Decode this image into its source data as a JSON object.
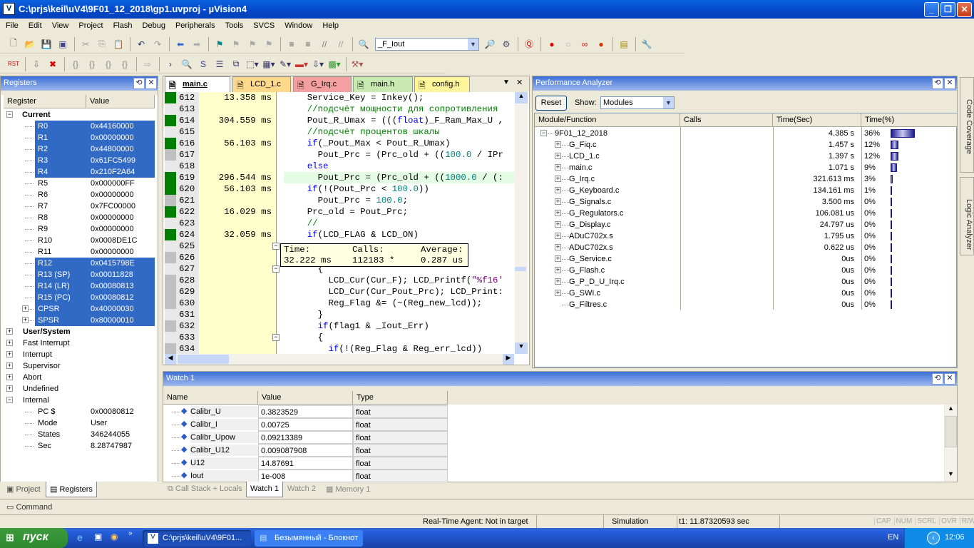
{
  "window": {
    "title": "C:\\prjs\\keil\\uV4\\9F01_12_2018\\gp1.uvproj - µVision4",
    "minimize": "_",
    "maximize": "❐",
    "close": "✕"
  },
  "menu": [
    "File",
    "Edit",
    "View",
    "Project",
    "Flash",
    "Debug",
    "Peripherals",
    "Tools",
    "SVCS",
    "Window",
    "Help"
  ],
  "toolbar1": {
    "icons": [
      [
        "new-file-icon",
        "🗋",
        "#555"
      ],
      [
        "open-icon",
        "📂",
        "#c90"
      ],
      [
        "save-icon",
        "💾",
        "#339"
      ],
      [
        "save-all-icon",
        "▣",
        "#448"
      ],
      "|",
      [
        "cut-icon",
        "✂",
        "#999"
      ],
      [
        "copy-icon",
        "⎘",
        "#999"
      ],
      [
        "paste-icon",
        "📋",
        "#a80"
      ],
      "|",
      [
        "undo-icon",
        "↶",
        "#236"
      ],
      [
        "redo-icon",
        "↷",
        "#999"
      ],
      "|",
      [
        "nav-back-icon",
        "⬅",
        "#36c"
      ],
      [
        "nav-forward-icon",
        "➡",
        "#aaa"
      ],
      "|",
      [
        "bookmark-icon",
        "⚑",
        "#088"
      ],
      [
        "bookmark-prev-icon",
        "⚑",
        "#aaa"
      ],
      [
        "bookmark-next-icon",
        "⚑",
        "#aaa"
      ],
      [
        "bookmark-clear-icon",
        "⚑",
        "#aaa"
      ],
      "|",
      [
        "indent-icon",
        "≡",
        "#555"
      ],
      [
        "unindent-icon",
        "≡",
        "#555"
      ],
      [
        "comment-icon",
        "//",
        "#777"
      ],
      [
        "uncomment-icon",
        "//",
        "#999"
      ],
      "|",
      [
        "find-in-files-icon",
        "🔍",
        "#a80"
      ]
    ],
    "find_value": "_F_Iout",
    "icons_after": [
      [
        "find-icon",
        "🔎",
        "#446"
      ],
      [
        "incremental-find-icon",
        "⚙",
        "#446"
      ],
      "|",
      [
        "debug-session-icon",
        "Ⓠ",
        "#c00"
      ],
      "|",
      [
        "breakpoint-icon",
        "●",
        "#d00"
      ],
      [
        "breakpoint-disable-icon",
        "○",
        "#aaa"
      ],
      [
        "breakpoints-disable-all-icon",
        "∞",
        "#d00"
      ],
      [
        "breakpoints-kill-all-icon",
        "●",
        "#c30"
      ],
      "|",
      [
        "window-config-icon",
        "▤",
        "#a80"
      ],
      "|",
      [
        "configure-icon",
        "🔧",
        "#445"
      ]
    ]
  },
  "toolbar2": {
    "icons": [
      [
        "reset-icon",
        "RST",
        "#c00"
      ],
      "|",
      [
        "run-icon",
        "⇩",
        "#777"
      ],
      [
        "stop-icon",
        "✖",
        "#d00"
      ],
      "|",
      [
        "step-into-icon",
        "{}",
        "#888"
      ],
      [
        "step-over-icon",
        "{}",
        "#888"
      ],
      [
        "step-out-icon",
        "{}",
        "#888"
      ],
      [
        "run-to-cursor-icon",
        "{}",
        "#888"
      ],
      "|",
      [
        "show-next-statement-icon",
        "⇨",
        "#aaa"
      ],
      "|",
      [
        "command-window-icon",
        "›",
        "#336"
      ],
      [
        "disassembly-window-icon",
        "🔍",
        "#336"
      ],
      [
        "symbols-window-icon",
        "S",
        "#339"
      ],
      [
        "registers-window-icon",
        "☰",
        "#336"
      ],
      [
        "call-stack-window-icon",
        "⧉",
        "#336"
      ],
      [
        "watch-window-icon",
        "⬚▾",
        "#336"
      ],
      [
        "memory-window-icon",
        "▦▾",
        "#336"
      ],
      [
        "serial-window-icon",
        "✎▾",
        "#336"
      ],
      [
        "analysis-window-icon",
        "▬▾",
        "#c33"
      ],
      [
        "trace-window-icon",
        "⇩▾",
        "#336"
      ],
      [
        "system-viewer-icon",
        "▩▾",
        "#393"
      ],
      "|",
      [
        "toolbox-icon",
        "⚒▾",
        "#a55"
      ]
    ]
  },
  "registers": {
    "title": "Registers",
    "columns": [
      "Register",
      "Value"
    ],
    "current_label": "Current",
    "current": [
      [
        "R0",
        "0x44160000",
        1
      ],
      [
        "R1",
        "0x00000000",
        1
      ],
      [
        "R2",
        "0x44800000",
        1
      ],
      [
        "R3",
        "0x61FC5499",
        1
      ],
      [
        "R4",
        "0x210F2A64",
        1
      ],
      [
        "R5",
        "0x000000FF",
        0
      ],
      [
        "R6",
        "0x00000000",
        0
      ],
      [
        "R7",
        "0x7FC00000",
        0
      ],
      [
        "R8",
        "0x00000000",
        0
      ],
      [
        "R9",
        "0x00000000",
        0
      ],
      [
        "R10",
        "0x0008DE1C",
        0
      ],
      [
        "R11",
        "0x00000000",
        0
      ],
      [
        "R12",
        "0x0415798E",
        1
      ],
      [
        "R13 (SP)",
        "0x00011828",
        1
      ],
      [
        "R14 (LR)",
        "0x00080813",
        1
      ],
      [
        "R15 (PC)",
        "0x00080812",
        1
      ],
      [
        "CPSR",
        "0x40000030",
        1,
        "+"
      ],
      [
        "SPSR",
        "0x80000010",
        1,
        "+"
      ]
    ],
    "groups": [
      "User/System",
      "Fast Interrupt",
      "Interrupt",
      "Supervisor",
      "Abort",
      "Undefined",
      "Internal"
    ],
    "internal": [
      [
        "PC  $",
        "0x00080812"
      ],
      [
        "Mode",
        "User"
      ],
      [
        "States",
        "346244055"
      ],
      [
        "Sec",
        "8.28747987"
      ]
    ],
    "tabs": [
      "Project",
      "Registers"
    ],
    "active_tab": "Registers"
  },
  "editor": {
    "tabs": [
      "main.c",
      "LCD_1.c",
      "G_Irq.c",
      "main.h",
      "config.h"
    ],
    "tab_colors": [
      "#ece9d8",
      "#ffd98a",
      "#f4a0a0",
      "#c8eab0",
      "#fff59a"
    ],
    "lines": [
      {
        "n": "612",
        "t": "13.358 ms",
        "m": "g",
        "code": [
          [
            "    Service_Key = Inkey();",
            ""
          ]
        ]
      },
      {
        "n": "613",
        "t": "",
        "m": "",
        "code": [
          [
            "    //подсчёт мощности для сопротивления",
            "cm"
          ]
        ]
      },
      {
        "n": "614",
        "t": "304.559 ms",
        "m": "g",
        "code": [
          [
            "    Pout_R_Umax = (((",
            ""
          ],
          [
            "float",
            "kw"
          ],
          [
            ")_F_Ram_Max_U ,",
            ""
          ]
        ]
      },
      {
        "n": "615",
        "t": "",
        "m": "",
        "code": [
          [
            "    //подсчёт процентов шкалы",
            "cm"
          ]
        ]
      },
      {
        "n": "616",
        "t": "56.103 ms",
        "m": "g",
        "code": [
          [
            "    ",
            ""
          ],
          [
            "if",
            "kw"
          ],
          [
            "(_Pout_Max < Pout_R_Umax)",
            ""
          ]
        ]
      },
      {
        "n": "617",
        "t": "",
        "m": "x",
        "code": [
          [
            "      Pout_Prc = (Prc_old + ((",
            ""
          ],
          [
            "100.0",
            "num"
          ],
          [
            " / IPr",
            ""
          ]
        ]
      },
      {
        "n": "618",
        "t": "",
        "m": "",
        "code": [
          [
            "    ",
            ""
          ],
          [
            "else",
            "kw"
          ]
        ]
      },
      {
        "n": "619",
        "t": "296.544 ms",
        "m": "g",
        "hl": true,
        "code": [
          [
            "      Pout_Prc = (Prc_old + ((",
            ""
          ],
          [
            "1000.0",
            "num"
          ],
          [
            " / (:",
            ""
          ]
        ]
      },
      {
        "n": "620",
        "t": "56.103 ms",
        "m": "g",
        "code": [
          [
            "    ",
            ""
          ],
          [
            "if",
            "kw"
          ],
          [
            "(!(Pout_Prc < ",
            ""
          ],
          [
            "100.0",
            "num"
          ],
          [
            "))",
            ""
          ]
        ]
      },
      {
        "n": "621",
        "t": "",
        "m": "x",
        "code": [
          [
            "      Pout_Prc = ",
            ""
          ],
          [
            "100.0",
            "num"
          ],
          [
            ";",
            ""
          ]
        ]
      },
      {
        "n": "622",
        "t": "16.029 ms",
        "m": "g",
        "code": [
          [
            "    Prc_old = Pout_Prc;",
            ""
          ]
        ]
      },
      {
        "n": "623",
        "t": "",
        "m": "",
        "code": [
          [
            "    //",
            "cm"
          ]
        ]
      },
      {
        "n": "624",
        "t": "32.059 ms",
        "m": "g",
        "code": [
          [
            "    ",
            ""
          ],
          [
            "if",
            "kw"
          ],
          [
            "(LCD_FLAG & LCD_ON)",
            ""
          ]
        ]
      },
      {
        "n": "625",
        "t": "",
        "m": "",
        "code": []
      },
      {
        "n": "626",
        "t": "",
        "m": "x",
        "code": []
      },
      {
        "n": "627",
        "t": "",
        "m": "",
        "code": [
          [
            "      {",
            ""
          ]
        ]
      },
      {
        "n": "628",
        "t": "",
        "m": "x",
        "code": [
          [
            "        LCD_Cur(Cur_F); LCD_Printf(",
            ""
          ],
          [
            "\"%f16'",
            "str"
          ]
        ]
      },
      {
        "n": "629",
        "t": "",
        "m": "x",
        "code": [
          [
            "        LCD_Cur(Cur_Pout_Prc); LCD_Print:",
            ""
          ]
        ]
      },
      {
        "n": "630",
        "t": "",
        "m": "x",
        "code": [
          [
            "        Reg_Flag &= (~(Reg_new_lcd));",
            ""
          ]
        ]
      },
      {
        "n": "631",
        "t": "",
        "m": "",
        "code": [
          [
            "      }",
            ""
          ]
        ]
      },
      {
        "n": "632",
        "t": "",
        "m": "x",
        "code": [
          [
            "      ",
            ""
          ],
          [
            "if",
            "kw"
          ],
          [
            "(flag1 & _Iout_Err)",
            ""
          ]
        ]
      },
      {
        "n": "633",
        "t": "",
        "m": "",
        "code": [
          [
            "      {",
            ""
          ]
        ]
      },
      {
        "n": "634",
        "t": "",
        "m": "x",
        "code": [
          [
            "        ",
            ""
          ],
          [
            "if",
            "kw"
          ],
          [
            "(!(Reg_Flag & Reg_err_lcd))",
            ""
          ]
        ]
      }
    ],
    "tooltip": {
      "time_label": "Time:",
      "calls_label": "Calls:",
      "avg_label": "Average:",
      "time": "32.222 ms",
      "calls": "112183 *",
      "avg": "0.287 us"
    }
  },
  "perf": {
    "title": "Performance Analyzer",
    "reset": "Reset",
    "show_label": "Show:",
    "show_value": "Modules",
    "columns": [
      "Module/Function",
      "Calls",
      "Time(Sec)",
      "Time(%)"
    ],
    "rows": [
      [
        "9F01_12_2018",
        "4.385 s",
        "36%",
        36,
        "-"
      ],
      [
        "G_Fiq.c",
        "1.457 s",
        "12%",
        12,
        "+"
      ],
      [
        "LCD_1.c",
        "1.397 s",
        "12%",
        12,
        "+"
      ],
      [
        "main.c",
        "1.071 s",
        "9%",
        9,
        "+"
      ],
      [
        "G_Irq.c",
        "321.613 ms",
        "3%",
        3,
        "+"
      ],
      [
        "G_Keyboard.c",
        "134.161 ms",
        "1%",
        1,
        "+"
      ],
      [
        "G_Signals.c",
        "3.500 ms",
        "0%",
        0,
        "+"
      ],
      [
        "G_Regulators.c",
        "106.081 us",
        "0%",
        0,
        "+"
      ],
      [
        "G_Display.c",
        "24.797 us",
        "0%",
        0,
        "+"
      ],
      [
        "ADuC702x.s",
        "1.795 us",
        "0%",
        0,
        "+"
      ],
      [
        "ADuC702x.s",
        "0.622 us",
        "0%",
        0,
        "+"
      ],
      [
        "G_Service.c",
        "0us",
        "0%",
        0,
        "+"
      ],
      [
        "G_Flash.c",
        "0us",
        "0%",
        0,
        "+"
      ],
      [
        "G_P_D_U_Irq.c",
        "0us",
        "0%",
        0,
        "+"
      ],
      [
        "G_SWI.c",
        "0us",
        "0%",
        0,
        "+"
      ],
      [
        "G_Filtres.c",
        "0us",
        "0%",
        0,
        ""
      ]
    ],
    "bar_color": "#1a1a8c"
  },
  "side_tabs": [
    "Code Coverage",
    "Logic Analyzer"
  ],
  "watch": {
    "title": "Watch 1",
    "columns": [
      "Name",
      "Value",
      "Type"
    ],
    "rows": [
      [
        "Calibr_U",
        "0.3823529",
        "float"
      ],
      [
        "Calibr_I",
        "0.00725",
        "float"
      ],
      [
        "Calibr_Upow",
        "0.09213389",
        "float"
      ],
      [
        "Calibr_U12",
        "0.009087908",
        "float"
      ],
      [
        "U12",
        "14.87691",
        "float"
      ],
      [
        "Iout",
        "1e-008",
        "float"
      ]
    ],
    "tabs": [
      "Call Stack + Locals",
      "Watch 1",
      "Watch 2",
      "Memory 1"
    ],
    "active_tab": "Watch 1"
  },
  "command": {
    "tab": "Command"
  },
  "status": {
    "agent": "Real-Time Agent: Not in target",
    "mode": "Simulation",
    "t1": "t1: 11.87320593 sec",
    "keys": [
      "CAP",
      "NUM",
      "SCRL",
      "OVR",
      "R/W"
    ]
  },
  "taskbar": {
    "start": "пуск",
    "tasks": [
      "C:\\prjs\\keil\\uV4\\9F01...",
      "Безымянный - Блокнот"
    ],
    "lang": "EN",
    "clock": "12:06"
  }
}
